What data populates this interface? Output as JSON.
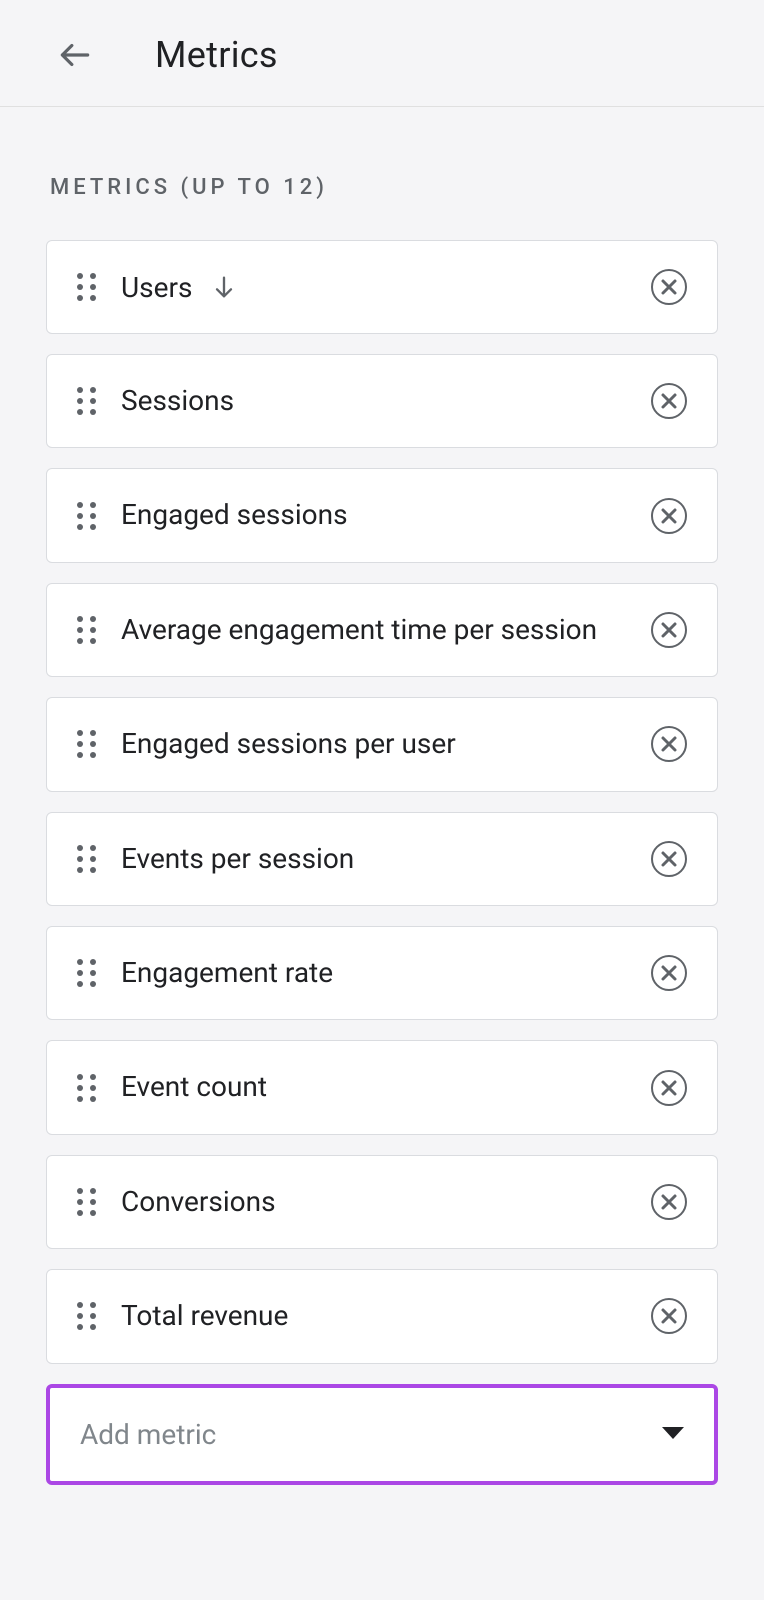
{
  "header": {
    "title": "Metrics"
  },
  "section": {
    "label": "METRICS (UP TO 12)"
  },
  "metrics": [
    {
      "label": "Users",
      "sorted": true
    },
    {
      "label": "Sessions",
      "sorted": false
    },
    {
      "label": "Engaged sessions",
      "sorted": false
    },
    {
      "label": "Average engagement time per session",
      "sorted": false
    },
    {
      "label": "Engaged sessions per user",
      "sorted": false
    },
    {
      "label": "Events per session",
      "sorted": false
    },
    {
      "label": "Engagement rate",
      "sorted": false
    },
    {
      "label": "Event count",
      "sorted": false
    },
    {
      "label": "Conversions",
      "sorted": false
    },
    {
      "label": "Total revenue",
      "sorted": false
    }
  ],
  "addMetric": {
    "label": "Add metric"
  }
}
